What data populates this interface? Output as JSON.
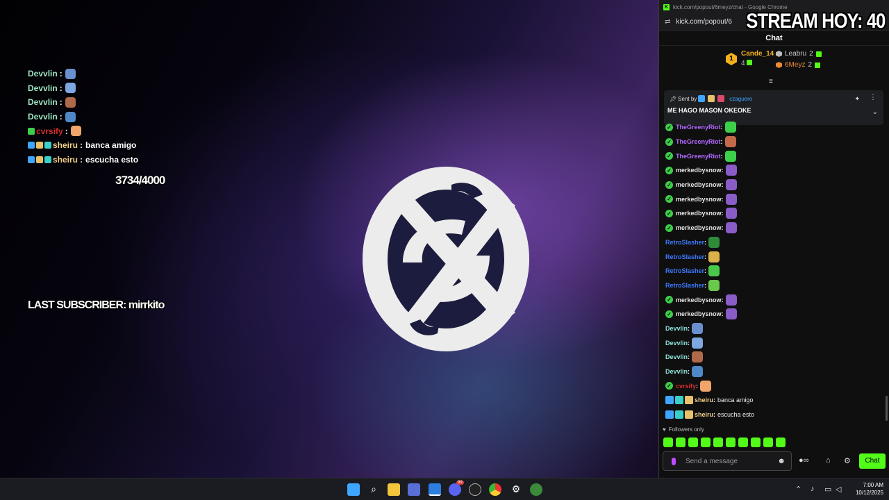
{
  "overlay": {
    "chat_lines": [
      {
        "user": "Devvlin",
        "sep": ":",
        "text": "",
        "emote_color": "#6a8fd1",
        "color": "teal",
        "badges": []
      },
      {
        "user": "Devvlin",
        "sep": ":",
        "text": "",
        "emote_color": "#7ea6e0",
        "color": "teal",
        "badges": []
      },
      {
        "user": "Devvlin",
        "sep": ":",
        "text": "",
        "emote_color": "#b06a4a",
        "color": "teal",
        "badges": []
      },
      {
        "user": "Devvlin",
        "sep": ":",
        "text": "",
        "emote_color": "#4f88c6",
        "color": "teal",
        "badges": []
      },
      {
        "user": "cvrsify",
        "sep": ":",
        "text": "",
        "emote_color": "#f2a56a",
        "color": "red",
        "badges": [
          "#3ecf4a"
        ]
      },
      {
        "user": "sheiru",
        "sep": ":",
        "text": "banca amigo",
        "emote_color": "",
        "color": "gold",
        "badges": [
          "#3ea6ff",
          "#e8c26a",
          "#38d0c8"
        ]
      },
      {
        "user": "sheiru",
        "sep": ":",
        "text": "escucha esto",
        "emote_color": "",
        "color": "gold",
        "badges": [
          "#3ea6ff",
          "#e8c26a",
          "#38d0c8"
        ]
      }
    ],
    "goal_count": "3734/4000",
    "last_subscriber": "LAST SUBSCRIBER: mirrkito"
  },
  "browser": {
    "title": "kick.com/popout/6meyz/chat - Google Chrome",
    "url": "kick.com/popout/6",
    "stream_banner": "STREAM HOY: 40"
  },
  "chat": {
    "header": "Chat",
    "leaderboard": {
      "first": {
        "rank": "1",
        "name": "Cande_14",
        "count": "4"
      },
      "second": {
        "name": "Leabru",
        "count": "2"
      },
      "third": {
        "name": "6Meyz",
        "count": "2"
      }
    },
    "pinned": {
      "sent_by_label": "Sent by",
      "user": "czaguero",
      "message": "ME HAGO MASON OKEOKE"
    },
    "messages": [
      {
        "user": "TheGreenyRiot",
        "color": "purple",
        "verified": true,
        "text": "",
        "emote_color": "#3ecf4a",
        "badges": []
      },
      {
        "user": "TheGreenyRiot",
        "color": "purple",
        "verified": true,
        "text": "",
        "emote_color": "#c46a4a",
        "badges": []
      },
      {
        "user": "TheGreenyRiot",
        "color": "purple",
        "verified": true,
        "text": "",
        "emote_color": "#3ecf4a",
        "badges": []
      },
      {
        "user": "merkedbysnow",
        "color": "white",
        "verified": true,
        "text": "",
        "emote_color": "#8a5cc8",
        "badges": []
      },
      {
        "user": "merkedbysnow",
        "color": "white",
        "verified": true,
        "text": "",
        "emote_color": "#8a5cc8",
        "badges": []
      },
      {
        "user": "merkedbysnow",
        "color": "white",
        "verified": true,
        "text": "",
        "emote_color": "#8a5cc8",
        "badges": []
      },
      {
        "user": "merkedbysnow",
        "color": "white",
        "verified": true,
        "text": "",
        "emote_color": "#8a5cc8",
        "badges": []
      },
      {
        "user": "merkedbysnow",
        "color": "white",
        "verified": true,
        "text": "",
        "emote_color": "#8a5cc8",
        "badges": []
      },
      {
        "user": "RetroSlasher",
        "color": "blue",
        "verified": false,
        "text": "",
        "emote_color": "#2f8a3a",
        "badges": []
      },
      {
        "user": "RetroSlasher",
        "color": "blue",
        "verified": false,
        "text": "",
        "emote_color": "#d9b24a",
        "badges": []
      },
      {
        "user": "RetroSlasher",
        "color": "blue",
        "verified": false,
        "text": "",
        "emote_color": "#4ac84a",
        "badges": []
      },
      {
        "user": "RetroSlasher",
        "color": "blue",
        "verified": false,
        "text": "",
        "emote_color": "#6ac84a",
        "badges": []
      },
      {
        "user": "merkedbysnow",
        "color": "white",
        "verified": true,
        "text": "",
        "emote_color": "#8a5cc8",
        "badges": []
      },
      {
        "user": "merkedbysnow",
        "color": "white",
        "verified": true,
        "text": "",
        "emote_color": "#8a5cc8",
        "badges": []
      },
      {
        "user": "Devvlin",
        "color": "teal",
        "verified": false,
        "text": "",
        "emote_color": "#6a8fd1",
        "badges": []
      },
      {
        "user": "Devvlin",
        "color": "teal",
        "verified": false,
        "text": "",
        "emote_color": "#7ea6e0",
        "badges": []
      },
      {
        "user": "Devvlin",
        "color": "teal",
        "verified": false,
        "text": "",
        "emote_color": "#b06a4a",
        "badges": []
      },
      {
        "user": "Devvlin",
        "color": "teal",
        "verified": false,
        "text": "",
        "emote_color": "#4f88c6",
        "badges": []
      },
      {
        "user": "cvrsify",
        "color": "red",
        "verified": true,
        "text": "",
        "emote_color": "#f2a56a",
        "badges": []
      },
      {
        "user": "sheiru",
        "color": "gold",
        "verified": false,
        "text": "banca amigo",
        "emote_color": "",
        "badges": [
          "#3ea6ff",
          "#38d0c8",
          "#e8c26a"
        ]
      },
      {
        "user": "sheiru",
        "color": "gold",
        "verified": false,
        "text": "escucha esto",
        "emote_color": "",
        "badges": [
          "#3ea6ff",
          "#38d0c8",
          "#e8c26a"
        ]
      }
    ],
    "followers_only": "Followers only",
    "input_placeholder": "Send a message",
    "send_label": "Chat",
    "accent": "#53fc18"
  },
  "taskbar": {
    "time": "7:00 AM",
    "date": "10/12/2025",
    "discord_badge": "99"
  }
}
